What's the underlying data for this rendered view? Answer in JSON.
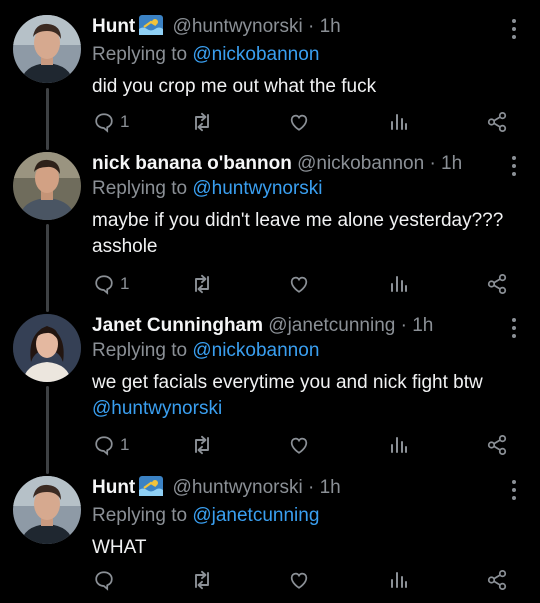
{
  "tweets": [
    {
      "name": "Hunt",
      "handle": "@huntwynorski",
      "time": "1h",
      "reply_prefix": "Replying to",
      "reply_to": "@nickobannon",
      "text": "did you crop me out what the fuck",
      "text_mention": "",
      "has_emoji": true,
      "reply_count": "1",
      "avatar_icon": "person-avatar"
    },
    {
      "name": "nick banana o'bannon",
      "handle": "@nickobannon",
      "time": "1h",
      "reply_prefix": "Replying to",
      "reply_to": "@huntwynorski",
      "text": "maybe if you didn't leave me alone yesterday??? asshole",
      "text_mention": "",
      "has_emoji": false,
      "reply_count": "1",
      "avatar_icon": "person-avatar"
    },
    {
      "name": "Janet Cunningham",
      "handle": "@janetcunning",
      "time": "1h",
      "reply_prefix": "Replying to",
      "reply_to": "@nickobannon",
      "text": "we get facials everytime you and nick fight btw",
      "text_mention": "@huntwynorski",
      "has_emoji": false,
      "reply_count": "1",
      "avatar_icon": "person-avatar"
    },
    {
      "name": "Hunt",
      "handle": "@huntwynorski",
      "time": "1h",
      "reply_prefix": "Replying to",
      "reply_to": "@janetcunning",
      "text": "WHAT",
      "text_mention": "",
      "has_emoji": true,
      "reply_count": "",
      "avatar_icon": "person-avatar"
    }
  ],
  "separator": "·",
  "icons": {
    "reply": "comment-icon",
    "retweet": "retweet-icon",
    "like": "heart-icon",
    "stats": "analytics-icon",
    "share": "share-icon",
    "more": "more-icon",
    "emoji": "swimmer-emoji"
  },
  "colors": {
    "background": "#000000",
    "mention": "#3a9ff0",
    "muted": "#8b9096",
    "text": "#f1f2f3"
  }
}
